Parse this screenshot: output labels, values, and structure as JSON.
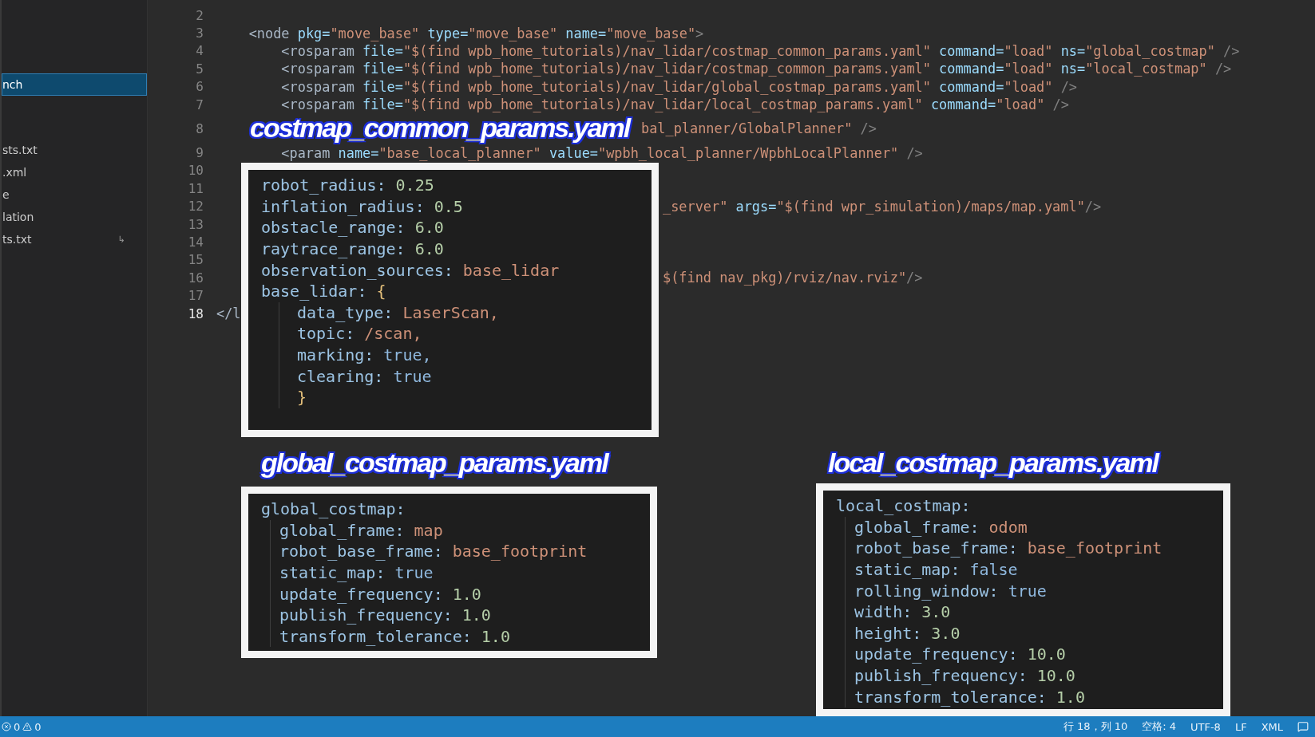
{
  "sidebar": {
    "groups": [
      {
        "items": [
          {
            "label": "nch",
            "selected": true
          }
        ]
      },
      {
        "items": [
          {
            "label": "sts.txt",
            "selected": false
          },
          {
            "label": ".xml",
            "selected": false
          },
          {
            "label": "e",
            "selected": false
          },
          {
            "label": "lation",
            "selected": false
          },
          {
            "label": "ts.txt",
            "selected": false,
            "badge": "↳"
          }
        ]
      }
    ]
  },
  "editor": {
    "lines": [
      {
        "number": "2",
        "current": false
      },
      {
        "number": "3",
        "current": false,
        "kind": "full",
        "text": "    <node pkg=\"move_base\" type=\"move_base\" name=\"move_base\">"
      },
      {
        "number": "4",
        "current": false,
        "kind": "full",
        "text": "        <rosparam file=\"$(find wpb_home_tutorials)/nav_lidar/costmap_common_params.yaml\" command=\"load\" ns=\"global_costmap\" />"
      },
      {
        "number": "5",
        "current": false,
        "kind": "full",
        "text": "        <rosparam file=\"$(find wpb_home_tutorials)/nav_lidar/costmap_common_params.yaml\" command=\"load\" ns=\"local_costmap\" />"
      },
      {
        "number": "6",
        "current": false,
        "kind": "full",
        "text": "        <rosparam file=\"$(find wpb_home_tutorials)/nav_lidar/global_costmap_params.yaml\" command=\"load\" />"
      },
      {
        "number": "7",
        "current": false,
        "kind": "full",
        "text": "        <rosparam file=\"$(find wpb_home_tutorials)/nav_lidar/local_costmap_params.yaml\" command=\"load\" />"
      },
      {
        "number": "8",
        "current": false,
        "kind": "after_title",
        "text": "bal_planner/GlobalPlanner\" />"
      },
      {
        "number": "9",
        "current": false,
        "kind": "full",
        "text": "        <param name=\"base_local_planner\" value=\"wpbh_local_planner/WpbhLocalPlanner\" />"
      },
      {
        "number": "10",
        "current": false
      },
      {
        "number": "11",
        "current": false
      },
      {
        "number": "12",
        "current": false,
        "kind": "after_box",
        "text": "_server\" args=\"$(find wpr_simulation)/maps/map.yaml\"/>"
      },
      {
        "number": "13",
        "current": false
      },
      {
        "number": "14",
        "current": false
      },
      {
        "number": "15",
        "current": false
      },
      {
        "number": "16",
        "current": false,
        "kind": "after_box",
        "text": "$(find nav_pkg)/rviz/nav.rviz\"/>"
      },
      {
        "number": "17",
        "current": false
      },
      {
        "number": "18",
        "current": true,
        "kind": "full",
        "text": "</l"
      }
    ]
  },
  "panels": [
    {
      "title": "costmap_common_params.yaml",
      "lines": [
        {
          "key": "robot_radius:",
          "value": "0.25",
          "kind": "number"
        },
        {
          "key": "inflation_radius:",
          "value": "0.5",
          "kind": "number"
        },
        {
          "key": "obstacle_range:",
          "value": "6.0",
          "kind": "number"
        },
        {
          "key": "raytrace_range:",
          "value": "6.0",
          "kind": "number"
        },
        {
          "key": "observation_sources:",
          "value": "base_lidar",
          "kind": "string"
        },
        {
          "key": "base_lidar:",
          "value": "{",
          "kind": "brace",
          "children": [
            {
              "key": "data_type:",
              "value": "LaserScan,",
              "kind": "string"
            },
            {
              "key": "topic:",
              "value": "/scan,",
              "kind": "string"
            },
            {
              "key": "marking:",
              "value": "true,",
              "kind": "bool"
            },
            {
              "key": "clearing:",
              "value": "true",
              "kind": "bool"
            },
            {
              "value": "}",
              "kind": "brace"
            }
          ]
        }
      ]
    },
    {
      "title": "global_costmap_params.yaml",
      "lines": [
        {
          "key": "global_costmap:",
          "children": [
            {
              "key": "global_frame:",
              "value": "map",
              "kind": "string"
            },
            {
              "key": "robot_base_frame:",
              "value": "base_footprint",
              "kind": "string"
            },
            {
              "key": "static_map:",
              "value": "true",
              "kind": "bool"
            },
            {
              "key": "update_frequency:",
              "value": "1.0",
              "kind": "number"
            },
            {
              "key": "publish_frequency:",
              "value": "1.0",
              "kind": "number"
            },
            {
              "key": "transform_tolerance:",
              "value": "1.0",
              "kind": "number"
            }
          ]
        }
      ]
    },
    {
      "title": "local_costmap_params.yaml",
      "lines": [
        {
          "key": "local_costmap:",
          "children": [
            {
              "key": "global_frame:",
              "value": "odom",
              "kind": "string"
            },
            {
              "key": "robot_base_frame:",
              "value": "base_footprint",
              "kind": "string"
            },
            {
              "key": "static_map:",
              "value": "false",
              "kind": "bool"
            },
            {
              "key": "rolling_window:",
              "value": "true",
              "kind": "bool"
            },
            {
              "key": "width:",
              "value": "3.0",
              "kind": "number"
            },
            {
              "key": "height:",
              "value": "3.0",
              "kind": "number"
            },
            {
              "key": "update_frequency:",
              "value": "10.0",
              "kind": "number"
            },
            {
              "key": "publish_frequency:",
              "value": "10.0",
              "kind": "number"
            },
            {
              "key": "transform_tolerance:",
              "value": "1.0",
              "kind": "number"
            }
          ]
        }
      ]
    }
  ],
  "status_bar": {
    "errors": "0",
    "warnings": "0",
    "items": [
      "行 18，列 10",
      "空格: 4",
      "UTF-8",
      "LF",
      "XML"
    ]
  }
}
